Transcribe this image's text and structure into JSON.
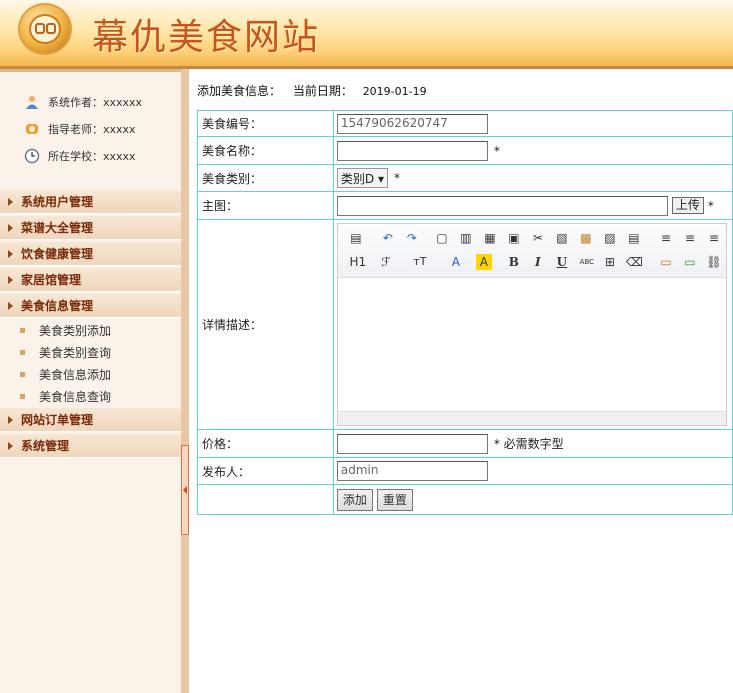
{
  "header": {
    "site_title": "幕仇美食网站"
  },
  "sidebar": {
    "info": [
      {
        "label": "系统作者：xxxxxx",
        "icon": "user-icon"
      },
      {
        "label": "指导老师：xxxxx",
        "icon": "teacher-icon"
      },
      {
        "label": "所在学校：xxxxx",
        "icon": "clock-icon"
      }
    ],
    "menu": [
      {
        "label": "系统用户管理"
      },
      {
        "label": "菜谱大全管理"
      },
      {
        "label": "饮食健康管理"
      },
      {
        "label": "家居馆管理"
      },
      {
        "label": "美食信息管理"
      },
      {
        "label": "网站订单管理"
      },
      {
        "label": "系统管理"
      }
    ],
    "submenu": [
      {
        "label": "美食类别添加"
      },
      {
        "label": "美食类别查询"
      },
      {
        "label": "美食信息添加"
      },
      {
        "label": "美食信息查询"
      }
    ]
  },
  "breadcrumb": {
    "title": "添加美食信息：",
    "date_label": "当前日期：",
    "date": "2019-01-19"
  },
  "form": {
    "code_label": "美食编号：",
    "code_value": "15479062620747",
    "name_label": "美食名称：",
    "name_value": "",
    "required": "*",
    "category_label": "美食类别：",
    "category_value": "类别D",
    "image_label": "主图：",
    "upload_label": "上传",
    "detail_label": "详情描述：",
    "price_label": "价格：",
    "price_hint": "* 必需数字型",
    "publisher_label": "发布人：",
    "publisher_value": "admin",
    "submit_label": "添加",
    "reset_label": "重置"
  },
  "toolbar_text": {
    "h1": "H1",
    "font": "ℱ",
    "size": "тT",
    "color": "A",
    "bg": "A",
    "bold": "B",
    "italic": "I",
    "underline": "U",
    "strike": "ABC"
  },
  "colors": {
    "accent": "#c8561a",
    "menu_text": "#7a2a0a",
    "table_border": "#66d2d8"
  }
}
